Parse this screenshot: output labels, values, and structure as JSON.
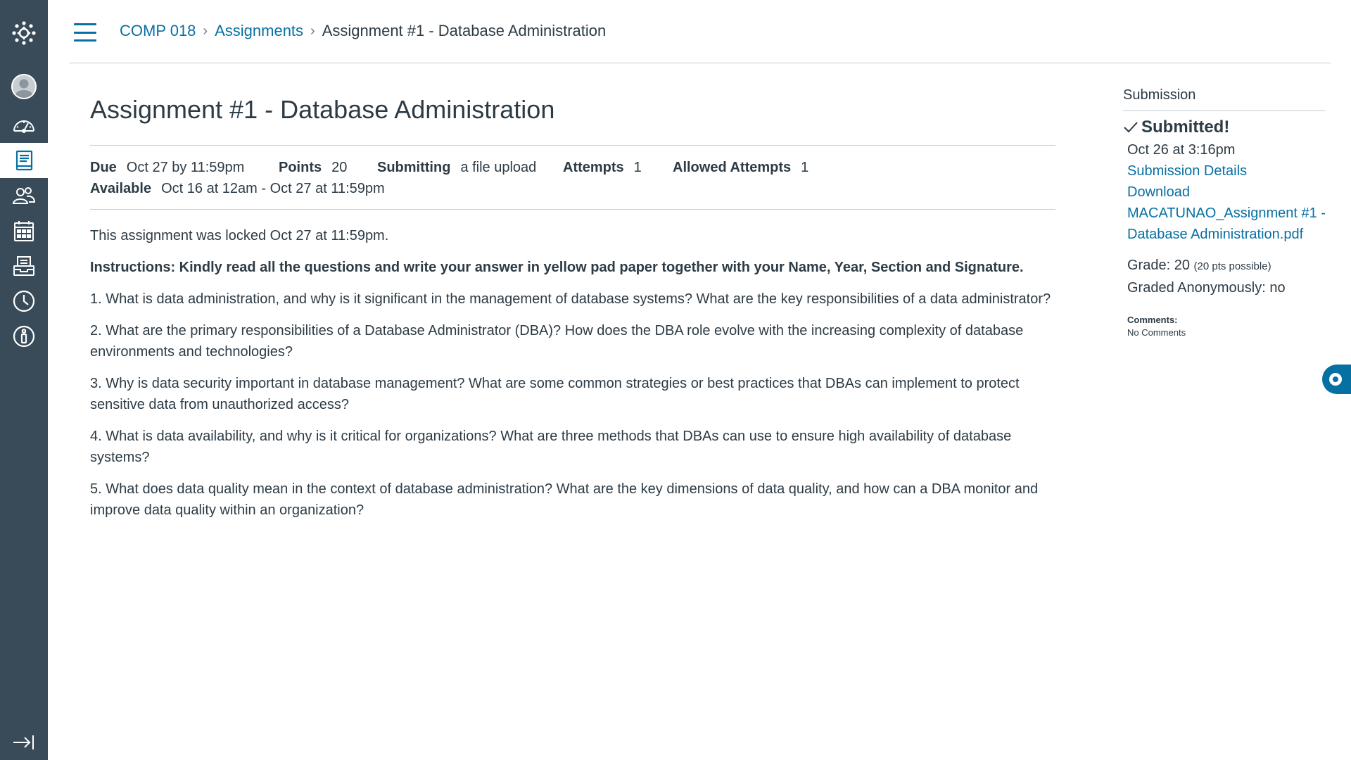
{
  "breadcrumb": {
    "course": "COMP 018",
    "section": "Assignments",
    "current": "Assignment #1 - Database Administration",
    "separator": "›"
  },
  "assignment": {
    "title": "Assignment #1 - Database Administration",
    "details": {
      "due_label": "Due",
      "due_value": "Oct 27 by 11:59pm",
      "points_label": "Points",
      "points_value": "20",
      "submitting_label": "Submitting",
      "submitting_value": "a file upload",
      "attempts_label": "Attempts",
      "attempts_value": "1",
      "allowed_attempts_label": "Allowed Attempts",
      "allowed_attempts_value": "1",
      "available_label": "Available",
      "available_value": "Oct 16 at 12am - Oct 27 at 11:59pm"
    },
    "locked_message": "This assignment was locked Oct 27 at 11:59pm.",
    "instructions": "Instructions: Kindly read all the questions and write your answer in yellow pad paper together with your Name, Year, Section and Signature.",
    "questions": [
      "1. What is data administration, and why is it significant in the management of database systems? What are the key responsibilities of a data administrator?",
      "2. What are the primary responsibilities of a Database Administrator (DBA)? How does the DBA role evolve with the increasing complexity of database environments and technologies?",
      "3. Why is data security important in database management? What are some common strategies or best practices that DBAs can implement to protect sensitive data from unauthorized access?",
      "4. What is data availability, and why is it critical for organizations? What are three methods that DBAs can use to ensure high availability of database systems?",
      "5. What does data quality mean in the context of database administration? What are the key dimensions of data quality, and how can a DBA monitor and improve data quality within an organization?"
    ]
  },
  "submission": {
    "heading": "Submission",
    "status": "Submitted!",
    "date": "Oct 26 at 3:16pm",
    "details_link": "Submission Details",
    "download_link": "Download",
    "file_name": "MACATUNAO_Assignment #1 - Database Administration.pdf",
    "grade_label": "Grade: 20",
    "grade_possible": "(20 pts possible)",
    "anonymous": "Graded Anonymously: no",
    "comments_label": "Comments:",
    "comments_value": "No Comments"
  },
  "icons": {
    "logo": "canvas-logo-icon",
    "account": "account-icon",
    "dashboard": "dashboard-icon",
    "courses": "courses-icon",
    "groups": "groups-icon",
    "calendar": "calendar-icon",
    "inbox": "inbox-icon",
    "history": "history-icon",
    "help": "help-icon",
    "collapse": "collapse-nav-icon"
  },
  "colors": {
    "nav_bg": "#394b58",
    "link": "#0770a3",
    "text": "#2d3b45",
    "border": "#c7cdd1"
  }
}
